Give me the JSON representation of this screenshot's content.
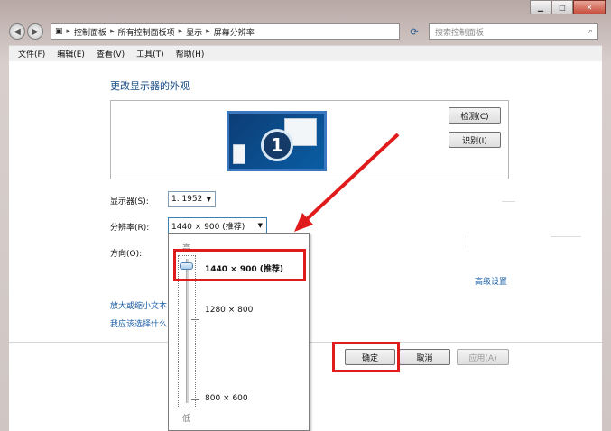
{
  "address": {
    "crumbs": [
      "控制面板",
      "所有控制面板项",
      "显示",
      "屏幕分辨率"
    ],
    "search_placeholder": "搜索控制面板"
  },
  "menu": [
    "文件(F)",
    "编辑(E)",
    "查看(V)",
    "工具(T)",
    "帮助(H)"
  ],
  "main": {
    "heading": "更改显示器的外观",
    "monitor_number": "1",
    "detect_button": "检测(C)",
    "identify_button": "识别(I)",
    "display_label": "显示器(S):",
    "display_value": "1. 1952",
    "resolution_label": "分辨率(R):",
    "resolution_value": "1440 × 900 (推荐)",
    "orientation_label": "方向(O):",
    "advanced_link": "高级设置",
    "link_text_size": "放大或缩小文本",
    "link_what_settings": "我应该选择什么"
  },
  "footer": {
    "ok": "确定",
    "cancel": "取消",
    "apply": "应用(A)"
  },
  "dropdown": {
    "high": "高",
    "low": "低",
    "options": [
      "1440 × 900 (推荐)",
      "1280 × 800",
      "800 × 600"
    ]
  }
}
